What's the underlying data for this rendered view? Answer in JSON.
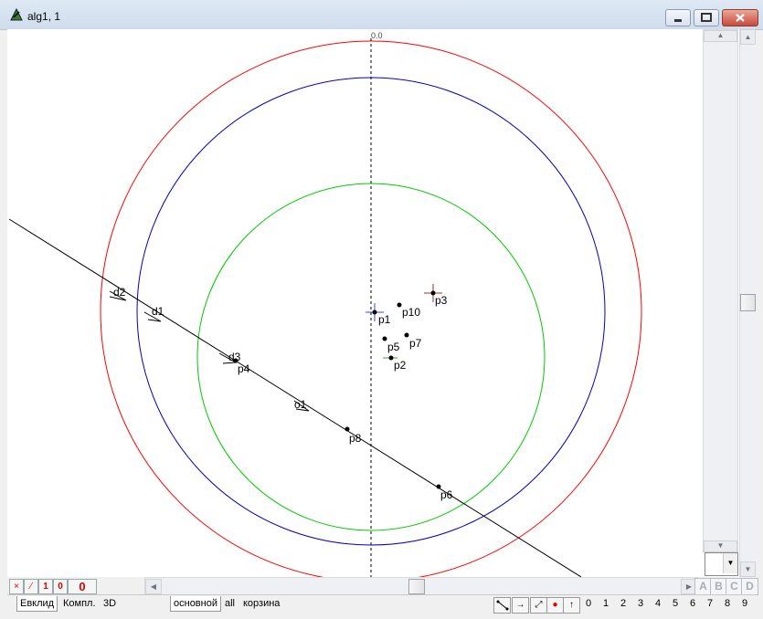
{
  "window": {
    "title": "alg1, 1"
  },
  "canvas": {
    "axis_label": "0.0",
    "points": [
      {
        "label": "p1"
      },
      {
        "label": "p10"
      },
      {
        "label": "p3"
      },
      {
        "label": "p5"
      },
      {
        "label": "p7"
      },
      {
        "label": "p2"
      },
      {
        "label": "p4"
      },
      {
        "label": "p8"
      },
      {
        "label": "p6"
      }
    ],
    "markers": [
      {
        "label": "d2"
      },
      {
        "label": "d1"
      },
      {
        "label": "d3"
      },
      {
        "label": "o1"
      }
    ],
    "circle_colors": {
      "outer": "#ff0000",
      "middle": "#0000c0",
      "inner": "#00cc00"
    }
  },
  "vscroll": {
    "combo_value": ""
  },
  "bottom_bar": {
    "mini_buttons": [
      "×",
      "⁄",
      "1",
      "0",
      "0"
    ],
    "abcd": [
      "A",
      "B",
      "C",
      "D"
    ]
  },
  "tabs": {
    "left": [
      "Евклид",
      "Компл.",
      "3D"
    ],
    "right": [
      "основной",
      "all",
      "корзина"
    ]
  },
  "digits": [
    "0",
    "1",
    "2",
    "3",
    "4",
    "5",
    "6",
    "7",
    "8",
    "9"
  ]
}
